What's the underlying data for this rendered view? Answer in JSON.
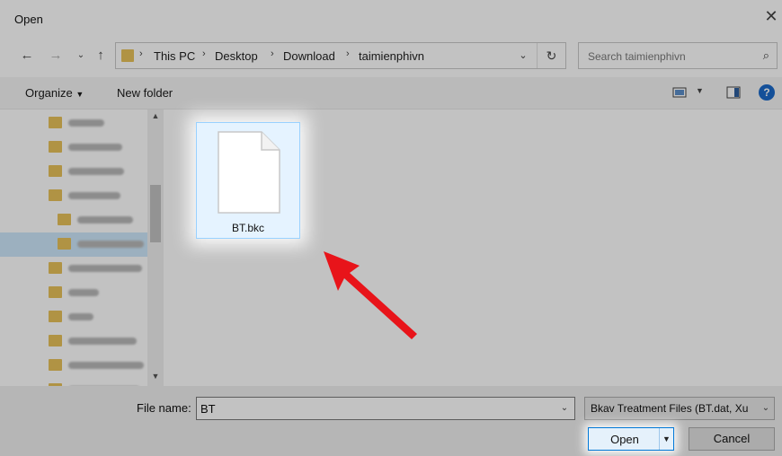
{
  "window": {
    "title": "Open"
  },
  "address": {
    "crumbs": [
      "This PC",
      "Desktop",
      "Download",
      "taimienphivn"
    ]
  },
  "search": {
    "placeholder": "Search taimienphivn"
  },
  "toolbar": {
    "organize": "Organize",
    "new_folder": "New folder",
    "help": "?"
  },
  "file": {
    "name": "BT.bkc"
  },
  "bottom": {
    "file_name_label": "File name:",
    "file_name_value": "BT",
    "file_type": "Bkav Treatment Files (BT.dat, Xu",
    "open_label": "Open",
    "cancel_label": "Cancel"
  },
  "icons": {
    "back": "arrow-left-icon",
    "forward": "arrow-right-icon",
    "recent": "chevron-down-icon",
    "up": "arrow-up-icon",
    "refresh": "refresh-icon",
    "search": "search-icon",
    "close": "close-icon"
  },
  "colors": {
    "accent": "#0078d7",
    "folder": "#e8c25a",
    "selection": "#cde8fb",
    "annotation_arrow": "#e8141a"
  }
}
